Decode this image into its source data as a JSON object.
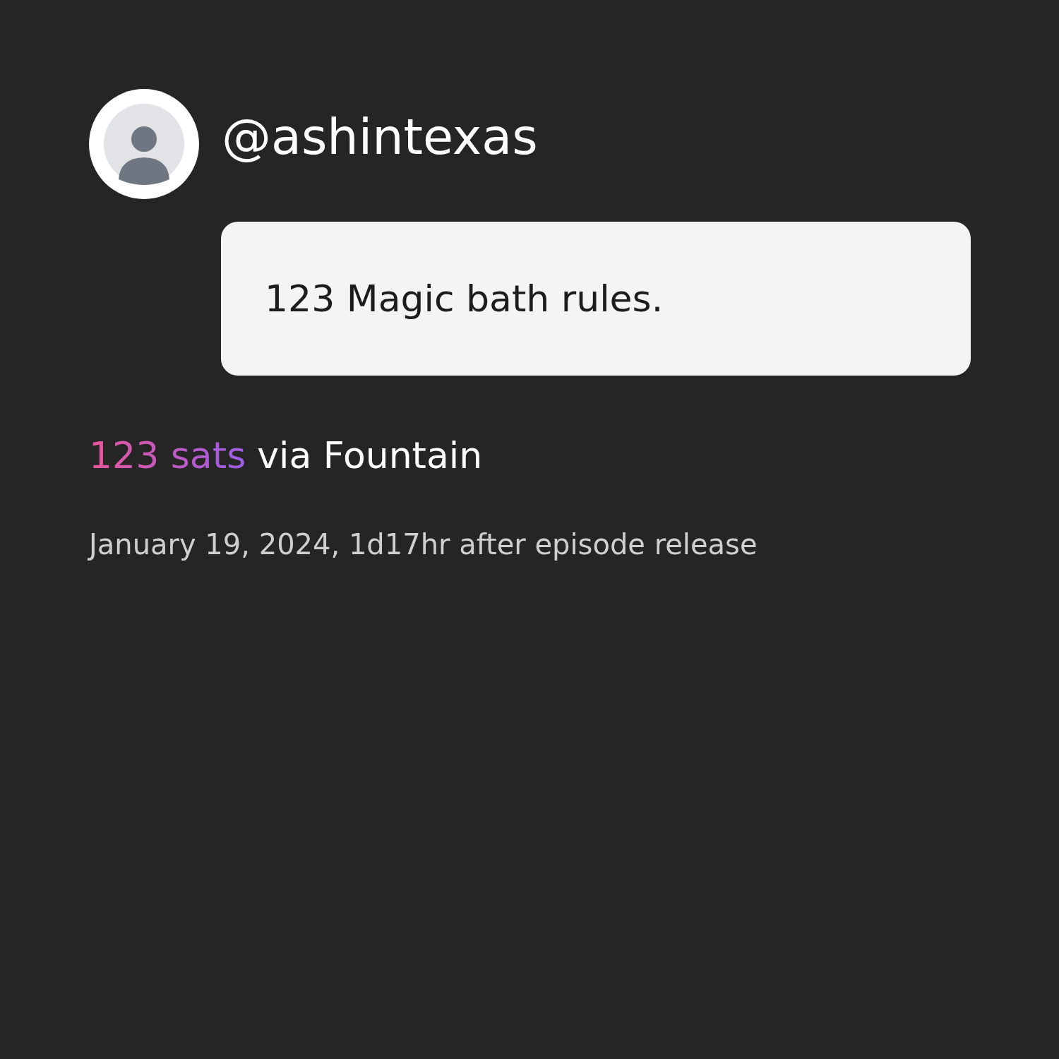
{
  "user": {
    "handle": "@ashintexas"
  },
  "message": {
    "text": "123 Magic bath rules."
  },
  "boost": {
    "amount": "123 sats",
    "via": "via Fountain"
  },
  "timestamp": "January 19, 2024, 1d17hr after episode release"
}
